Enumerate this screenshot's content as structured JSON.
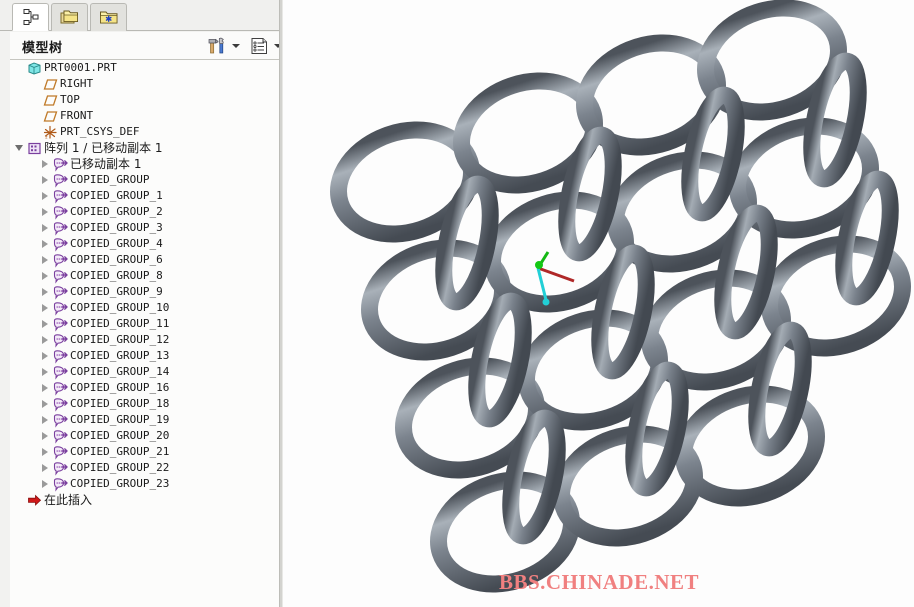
{
  "panel": {
    "tabs": [
      {
        "name": "model-tree-tab",
        "icon": "hierarchy-icon",
        "active": true
      },
      {
        "name": "folder-browser-tab",
        "icon": "folders-icon",
        "active": false
      },
      {
        "name": "favorites-folder-tab",
        "icon": "folder-star-icon",
        "active": false
      }
    ],
    "title": "模型树",
    "toolbar": {
      "settings_icon": "hammer-wrench-icon",
      "settings_caret": "chevron-down-icon",
      "display_icon": "list-document-icon",
      "display_caret": "chevron-down-icon"
    }
  },
  "tree": [
    {
      "label": "PRT0001.PRT",
      "level": 0,
      "toggle": "none",
      "icon": "part-cube-icon",
      "cjk": false
    },
    {
      "label": "RIGHT",
      "level": 1,
      "toggle": "none",
      "icon": "datum-plane-icon",
      "cjk": false
    },
    {
      "label": "TOP",
      "level": 1,
      "toggle": "none",
      "icon": "datum-plane-icon",
      "cjk": false
    },
    {
      "label": "FRONT",
      "level": 1,
      "toggle": "none",
      "icon": "datum-plane-icon",
      "cjk": false
    },
    {
      "label": "PRT_CSYS_DEF",
      "level": 1,
      "toggle": "none",
      "icon": "csys-icon",
      "cjk": false
    },
    {
      "label": "阵列 1 / 已移动副本 1",
      "level": 0,
      "toggle": "expanded",
      "icon": "pattern-icon",
      "cjk": true
    },
    {
      "label": "已移动副本 1",
      "level": 2,
      "toggle": "collapsed",
      "icon": "group-icon",
      "cjk": true
    },
    {
      "label": "COPIED_GROUP",
      "level": 2,
      "toggle": "collapsed",
      "icon": "group-icon",
      "cjk": false
    },
    {
      "label": "COPIED_GROUP_1",
      "level": 2,
      "toggle": "collapsed",
      "icon": "group-icon",
      "cjk": false
    },
    {
      "label": "COPIED_GROUP_2",
      "level": 2,
      "toggle": "collapsed",
      "icon": "group-icon",
      "cjk": false
    },
    {
      "label": "COPIED_GROUP_3",
      "level": 2,
      "toggle": "collapsed",
      "icon": "group-icon",
      "cjk": false
    },
    {
      "label": "COPIED_GROUP_4",
      "level": 2,
      "toggle": "collapsed",
      "icon": "group-icon",
      "cjk": false
    },
    {
      "label": "COPIED_GROUP_6",
      "level": 2,
      "toggle": "collapsed",
      "icon": "group-icon",
      "cjk": false
    },
    {
      "label": "COPIED_GROUP_8",
      "level": 2,
      "toggle": "collapsed",
      "icon": "group-icon",
      "cjk": false
    },
    {
      "label": "COPIED_GROUP_9",
      "level": 2,
      "toggle": "collapsed",
      "icon": "group-icon",
      "cjk": false
    },
    {
      "label": "COPIED_GROUP_10",
      "level": 2,
      "toggle": "collapsed",
      "icon": "group-icon",
      "cjk": false
    },
    {
      "label": "COPIED_GROUP_11",
      "level": 2,
      "toggle": "collapsed",
      "icon": "group-icon",
      "cjk": false
    },
    {
      "label": "COPIED_GROUP_12",
      "level": 2,
      "toggle": "collapsed",
      "icon": "group-icon",
      "cjk": false
    },
    {
      "label": "COPIED_GROUP_13",
      "level": 2,
      "toggle": "collapsed",
      "icon": "group-icon",
      "cjk": false
    },
    {
      "label": "COPIED_GROUP_14",
      "level": 2,
      "toggle": "collapsed",
      "icon": "group-icon",
      "cjk": false
    },
    {
      "label": "COPIED_GROUP_16",
      "level": 2,
      "toggle": "collapsed",
      "icon": "group-icon",
      "cjk": false
    },
    {
      "label": "COPIED_GROUP_18",
      "level": 2,
      "toggle": "collapsed",
      "icon": "group-icon",
      "cjk": false
    },
    {
      "label": "COPIED_GROUP_19",
      "level": 2,
      "toggle": "collapsed",
      "icon": "group-icon",
      "cjk": false
    },
    {
      "label": "COPIED_GROUP_20",
      "level": 2,
      "toggle": "collapsed",
      "icon": "group-icon",
      "cjk": false
    },
    {
      "label": "COPIED_GROUP_21",
      "level": 2,
      "toggle": "collapsed",
      "icon": "group-icon",
      "cjk": false
    },
    {
      "label": "COPIED_GROUP_22",
      "level": 2,
      "toggle": "collapsed",
      "icon": "group-icon",
      "cjk": false
    },
    {
      "label": "COPIED_GROUP_23",
      "level": 2,
      "toggle": "collapsed",
      "icon": "group-icon",
      "cjk": false
    },
    {
      "label": "在此插入",
      "level": 0,
      "toggle": "none",
      "icon": "insert-here-arrow-icon",
      "cjk": true
    }
  ],
  "viewport": {
    "watermark": "BBS.CHINADE.NET",
    "background_color": "#fdfdfd",
    "model": {
      "description": "chain-mail-ring-lattice",
      "ring_color": "#78808a",
      "ring_highlight": "#a8b0b8",
      "ring_shadow": "#444a52",
      "csys_axes": [
        {
          "name": "x-axis",
          "color": "#c02020"
        },
        {
          "name": "y-axis",
          "color": "#10b010"
        },
        {
          "name": "z-axis",
          "color": "#20d0d0"
        }
      ]
    }
  }
}
